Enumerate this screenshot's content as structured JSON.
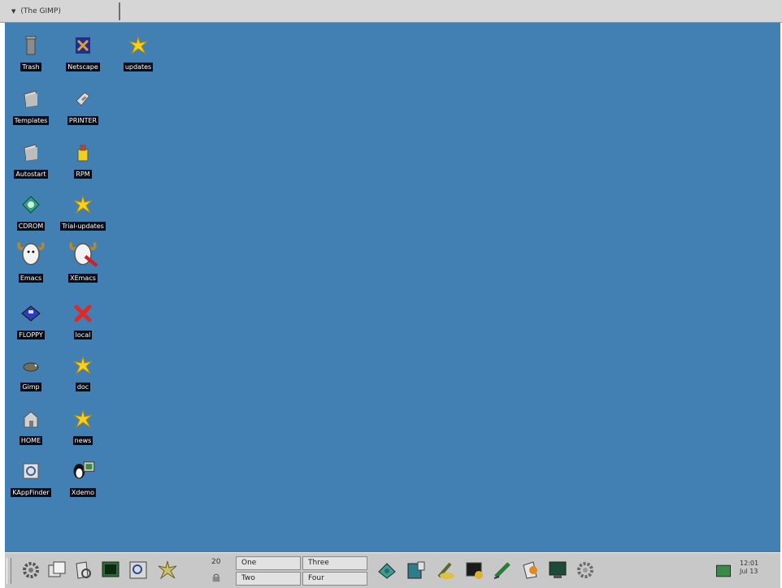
{
  "topbar": {
    "task_label": "(The GIMP)",
    "menu_arrow": "▼"
  },
  "desktop_icons": [
    {
      "label": "Trash",
      "icon": "trash-icon"
    },
    {
      "label": "Netscape",
      "icon": "netscape-icon"
    },
    {
      "label": "updates",
      "icon": "star-icon"
    },
    {
      "label": "Templates",
      "icon": "folder-icon"
    },
    {
      "label": "PRINTER",
      "icon": "printer-icon"
    },
    {
      "label": "Autostart",
      "icon": "folder-icon"
    },
    {
      "label": "RPM",
      "icon": "package-icon"
    },
    {
      "label": "CDROM",
      "icon": "cdrom-icon"
    },
    {
      "label": "Trial-updates",
      "icon": "star-icon"
    },
    {
      "label": "Emacs",
      "icon": "gnu-icon"
    },
    {
      "label": "XEmacs",
      "icon": "gnu-icon"
    },
    {
      "label": "FLOPPY",
      "icon": "floppy-icon"
    },
    {
      "label": "local",
      "icon": "x-icon"
    },
    {
      "label": "Gimp",
      "icon": "gimp-icon"
    },
    {
      "label": "doc",
      "icon": "star-icon"
    },
    {
      "label": "HOME",
      "icon": "home-icon"
    },
    {
      "label": "news",
      "icon": "star-icon"
    },
    {
      "label": "KAppFinder",
      "icon": "appfinder-icon"
    },
    {
      "label": "Xdemo",
      "icon": "tux-icon"
    }
  ],
  "panel": {
    "desktops": [
      "One",
      "Two",
      "Three",
      "Four"
    ],
    "pager_number": "20",
    "clock_time": "12:01",
    "clock_date": "Jul 13"
  },
  "colors": {
    "desktop": "#4280b4",
    "panel": "#c8c8c8",
    "label_bg": "#0a0a14"
  }
}
